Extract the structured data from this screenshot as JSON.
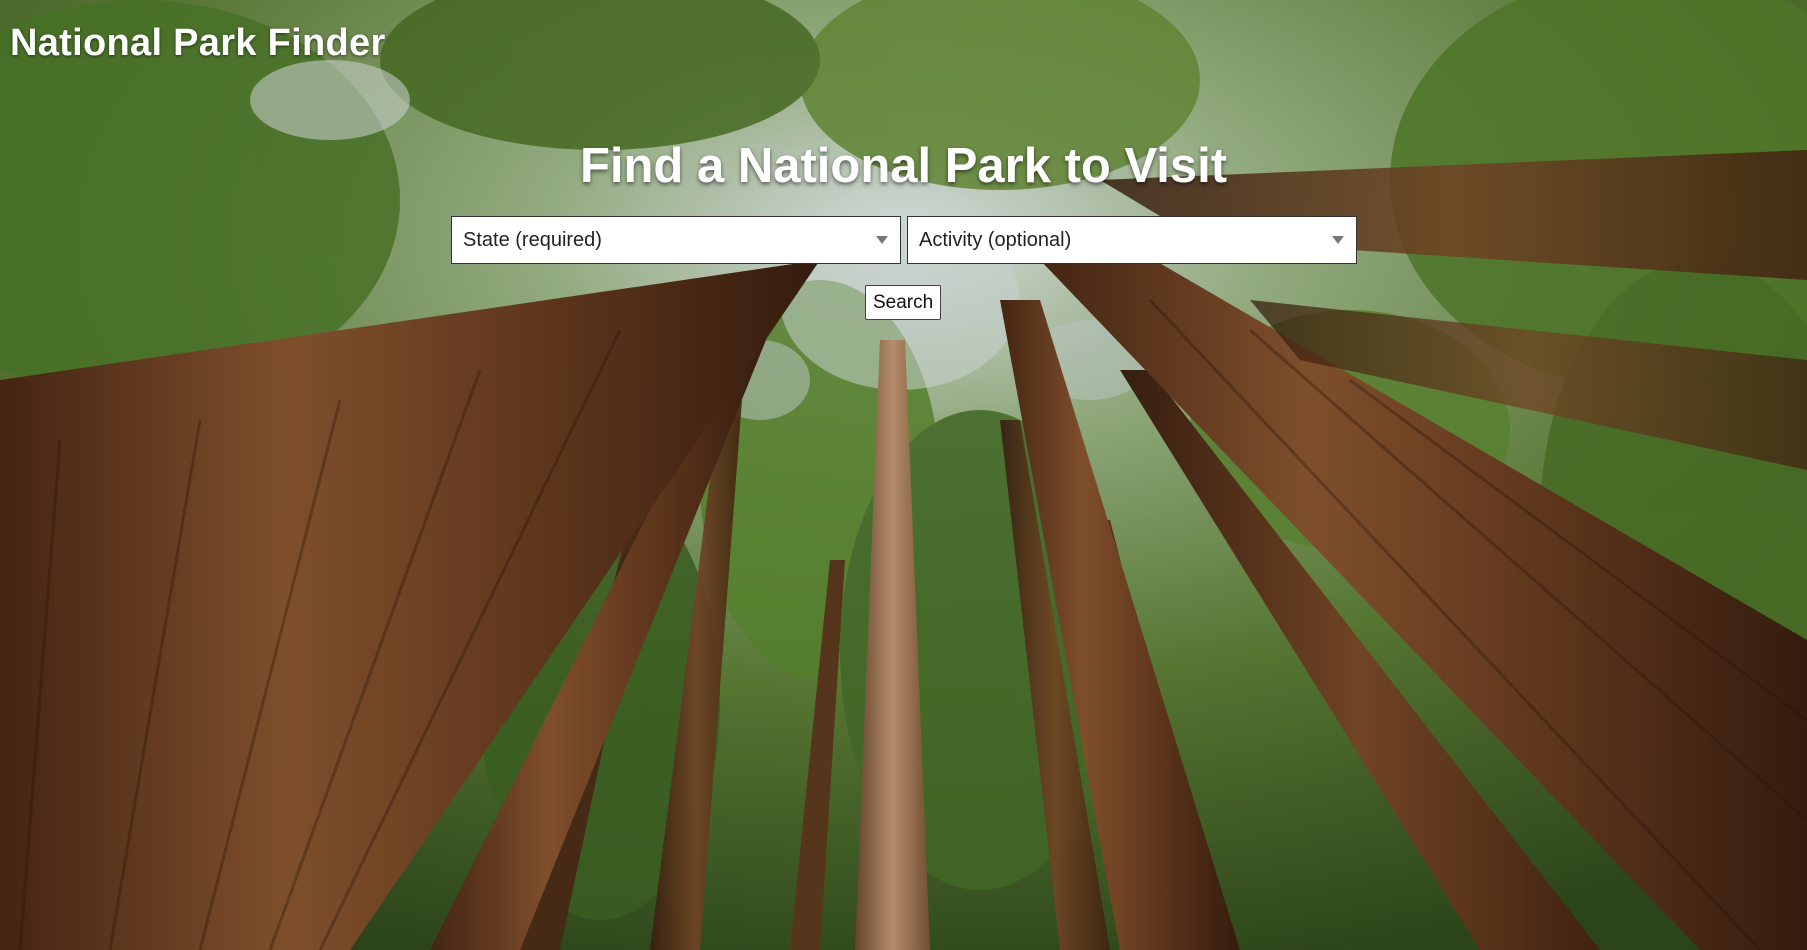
{
  "site": {
    "title": "National Park Finder"
  },
  "hero": {
    "heading": "Find a National Park to Visit",
    "background": "redwood-forest-canopy-photo"
  },
  "form": {
    "state_select": {
      "value": "State (required)",
      "icon": "chevron-down-icon"
    },
    "activity_select": {
      "value": "Activity (optional)",
      "icon": "chevron-down-icon"
    },
    "search_button": {
      "label": "Search"
    }
  },
  "colors": {
    "text_light": "#ffffff",
    "control_bg": "#ffffff",
    "control_border": "#333333",
    "forest_green": "#4a6a2e",
    "bark_brown": "#6b3f22"
  }
}
